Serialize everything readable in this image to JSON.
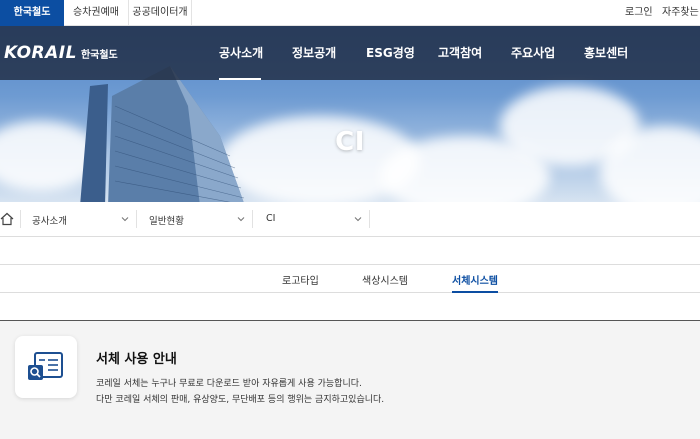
{
  "utility_bar": {
    "site_tabs": [
      {
        "label": "한국철도",
        "active": true
      },
      {
        "label": "승차권예매",
        "active": false
      },
      {
        "label": "공공데이터개방",
        "active": false
      }
    ],
    "login": "로그인",
    "faq": "자주찾는 메"
  },
  "header": {
    "logo_word": "KORAIL",
    "logo_sub": "한국철도",
    "nav": [
      "공사소개",
      "정보공개",
      "ESG경영",
      "고객참여",
      "주요사업",
      "홍보센터"
    ],
    "active_nav": "공사소개"
  },
  "hero": {
    "title": "CI"
  },
  "breadcrumb": {
    "items": [
      "공사소개",
      "일반현황",
      "CI"
    ]
  },
  "subtabs": {
    "items": [
      {
        "label": "로고타입",
        "active": false
      },
      {
        "label": "색상시스템",
        "active": false
      },
      {
        "label": "서체시스템",
        "active": true
      }
    ]
  },
  "content": {
    "title": "서체 사용 안내",
    "lines": [
      "코레일 서체는 누구나 무료로 다운로드 받아 자유롭게 사용 가능합니다.",
      "다만 코레일 서체의 판매, 유상양도, 무단배포 등의 행위는 금지하고있습니다."
    ]
  },
  "colors": {
    "brand_blue": "#0c4ea2",
    "header_dark": "#1e283c",
    "content_bg": "#f4f4f4"
  },
  "icons": [
    "home-icon",
    "chevron-down-icon",
    "font-document-search-icon"
  ]
}
